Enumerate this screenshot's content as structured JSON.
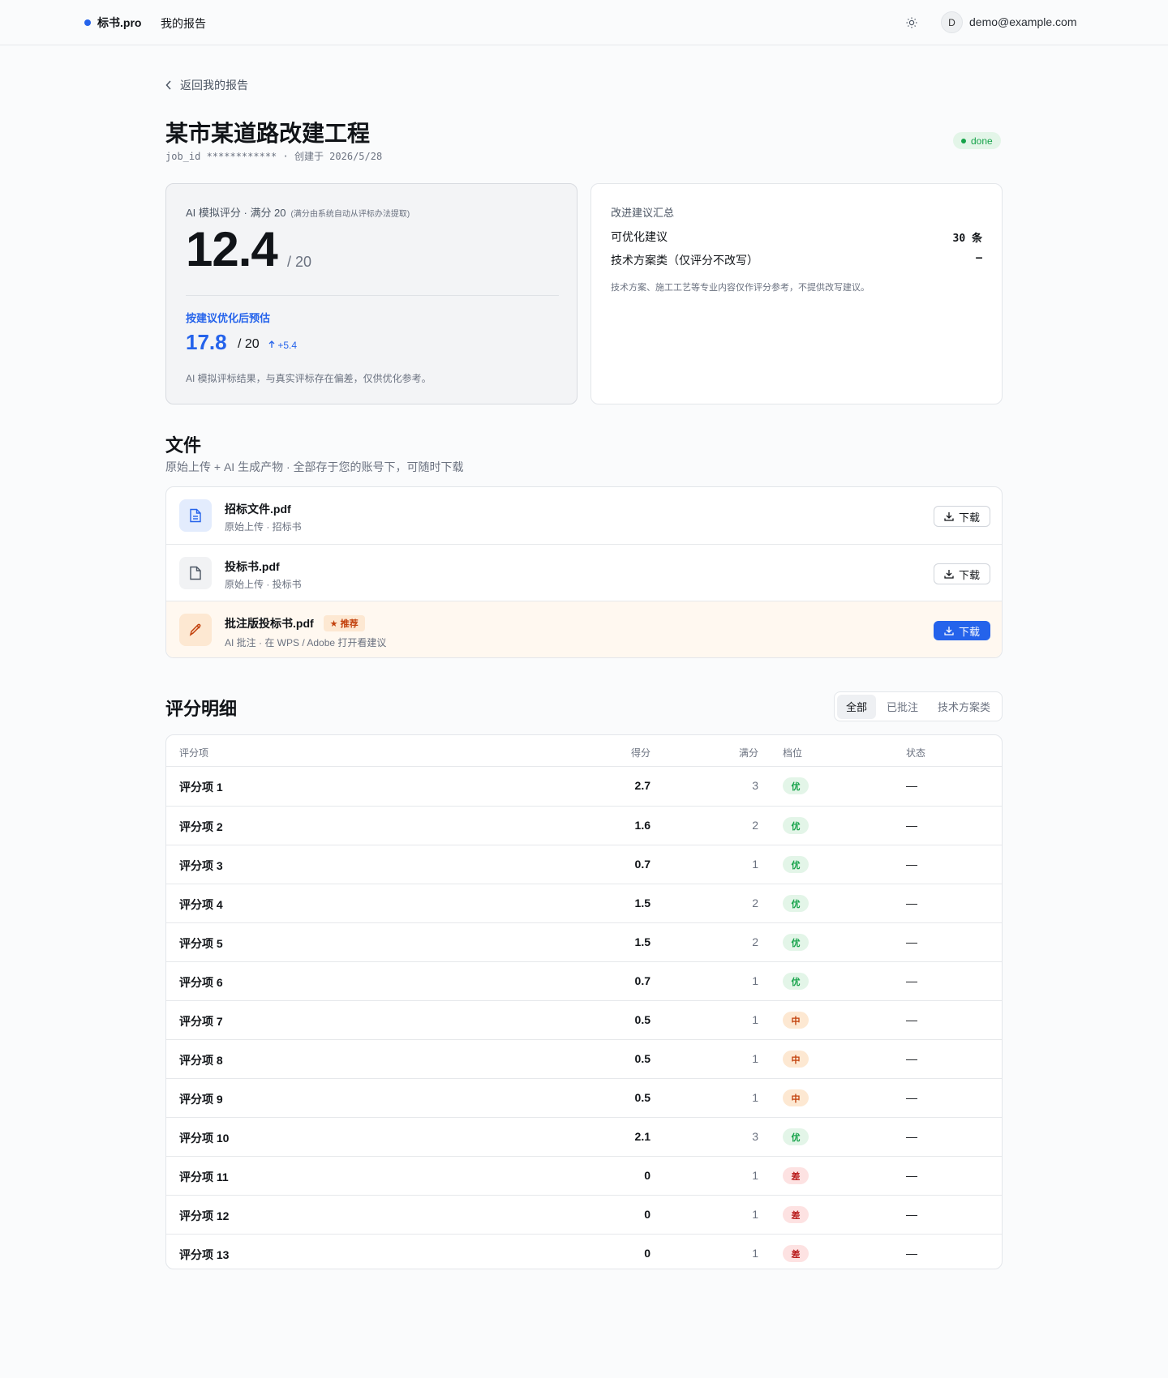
{
  "nav": {
    "brand": "标书.pro",
    "my_reports": "我的报告",
    "avatar_initial": "D",
    "email": "demo@example.com"
  },
  "back_label": "返回我的报告",
  "title": "某市某道路改建工程",
  "meta": "job_id ************ · 创建于 2026/5/28",
  "status": "done",
  "score_card": {
    "label": "AI 模拟评分 · 满分 20",
    "label_note": "(满分由系统自动从评标办法提取)",
    "score": "12.4",
    "of": "/ 20",
    "optimized_label": "按建议优化后预估",
    "optimized_score": "17.8",
    "optimized_of": "/ 20",
    "delta": "+5.4",
    "note": "AI 模拟评标结果，与真实评标存在偏差，仅供优化参考。"
  },
  "summary_card": {
    "title": "改进建议汇总",
    "rows": [
      {
        "label": "可优化建议",
        "value": "30 条"
      },
      {
        "label": "技术方案类（仅评分不改写）",
        "value": "–"
      }
    ],
    "note": "技术方案、施工工艺等专业内容仅作评分参考，不提供改写建议。"
  },
  "files": {
    "heading": "文件",
    "subheading": "原始上传 + AI 生成产物 · 全部存于您的账号下，可随时下载",
    "items": [
      {
        "name": "招标文件.pdf",
        "sub": "原始上传 · 招标书",
        "button": "下载",
        "icon": "document-icon"
      },
      {
        "name": "投标书.pdf",
        "sub": "原始上传 · 投标书",
        "button": "下载",
        "icon": "file-icon"
      },
      {
        "name": "批注版投标书.pdf",
        "badge": "★ 推荐",
        "sub": "AI 批注 · 在 WPS / Adobe 打开看建议",
        "button": "下载",
        "icon": "pencil-icon"
      }
    ]
  },
  "detail": {
    "heading": "评分明细",
    "filters": [
      "全部",
      "已批注",
      "技术方案类"
    ],
    "active_filter": "全部",
    "columns": [
      "评分项",
      "得分",
      "满分",
      "档位",
      "状态"
    ],
    "rows": [
      {
        "name": "评分项 1",
        "score": "2.7",
        "max": "3",
        "grade": "优",
        "status": "—"
      },
      {
        "name": "评分项 2",
        "score": "1.6",
        "max": "2",
        "grade": "优",
        "status": "—"
      },
      {
        "name": "评分项 3",
        "score": "0.7",
        "max": "1",
        "grade": "优",
        "status": "—"
      },
      {
        "name": "评分项 4",
        "score": "1.5",
        "max": "2",
        "grade": "优",
        "status": "—"
      },
      {
        "name": "评分项 5",
        "score": "1.5",
        "max": "2",
        "grade": "优",
        "status": "—"
      },
      {
        "name": "评分项 6",
        "score": "0.7",
        "max": "1",
        "grade": "优",
        "status": "—"
      },
      {
        "name": "评分项 7",
        "score": "0.5",
        "max": "1",
        "grade": "中",
        "status": "—"
      },
      {
        "name": "评分项 8",
        "score": "0.5",
        "max": "1",
        "grade": "中",
        "status": "—"
      },
      {
        "name": "评分项 9",
        "score": "0.5",
        "max": "1",
        "grade": "中",
        "status": "—"
      },
      {
        "name": "评分项 10",
        "score": "2.1",
        "max": "3",
        "grade": "优",
        "status": "—"
      },
      {
        "name": "评分项 11",
        "score": "0",
        "max": "1",
        "grade": "差",
        "status": "—"
      },
      {
        "name": "评分项 12",
        "score": "0",
        "max": "1",
        "grade": "差",
        "status": "—"
      },
      {
        "name": "评分项 13",
        "score": "0",
        "max": "1",
        "grade": "差",
        "status": "—"
      }
    ]
  },
  "colors": {
    "accent": "#2563eb",
    "good": "#16a34a",
    "mid": "#c2410c",
    "bad": "#b91c1c"
  }
}
